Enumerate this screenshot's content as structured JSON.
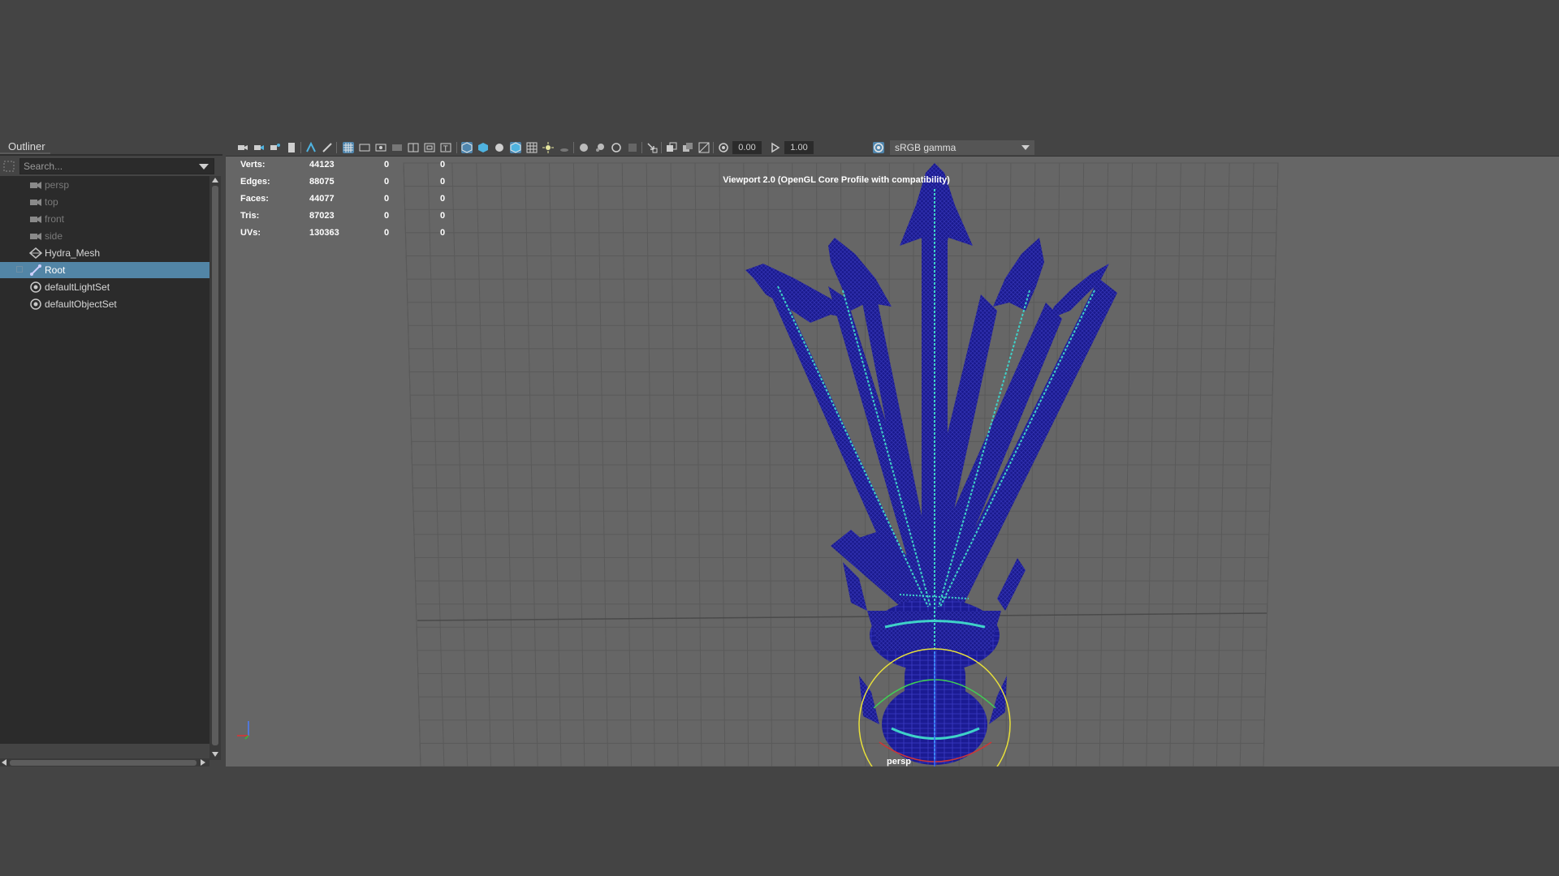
{
  "outliner": {
    "title": "Outliner",
    "search_placeholder": "Search...",
    "items": [
      {
        "label": "persp",
        "icon": "camera-icon",
        "dim": true
      },
      {
        "label": "top",
        "icon": "camera-icon",
        "dim": true
      },
      {
        "label": "front",
        "icon": "camera-icon",
        "dim": true
      },
      {
        "label": "side",
        "icon": "camera-icon",
        "dim": true
      },
      {
        "label": "Hydra_Mesh",
        "icon": "mesh-icon",
        "dim": false
      },
      {
        "label": "Root",
        "icon": "joint-icon",
        "dim": false,
        "selected": true,
        "expandable": true
      },
      {
        "label": "defaultLightSet",
        "icon": "set-icon",
        "dim": false
      },
      {
        "label": "defaultObjectSet",
        "icon": "set-icon",
        "dim": false
      }
    ]
  },
  "toolbar": {
    "exposure_value": "0.00",
    "gamma_value": "1.00",
    "color_space": "sRGB gamma"
  },
  "viewport": {
    "title": "Viewport 2.0 (OpenGL Core Profile with compatibility)",
    "camera": "persp",
    "hud": [
      {
        "label": "Verts:",
        "value": "44123",
        "sel": "0",
        "comp": "0"
      },
      {
        "label": "Edges:",
        "value": "88075",
        "sel": "0",
        "comp": "0"
      },
      {
        "label": "Faces:",
        "value": "44077",
        "sel": "0",
        "comp": "0"
      },
      {
        "label": "Tris:",
        "value": "87023",
        "sel": "0",
        "comp": "0"
      },
      {
        "label": "UVs:",
        "value": "130363",
        "sel": "0",
        "comp": "0"
      }
    ]
  },
  "colors": {
    "wireframe": "#1a1a8c",
    "joints": "#3fd1c8",
    "selection": "#5285a6",
    "control_ring": "#e8e03a"
  }
}
